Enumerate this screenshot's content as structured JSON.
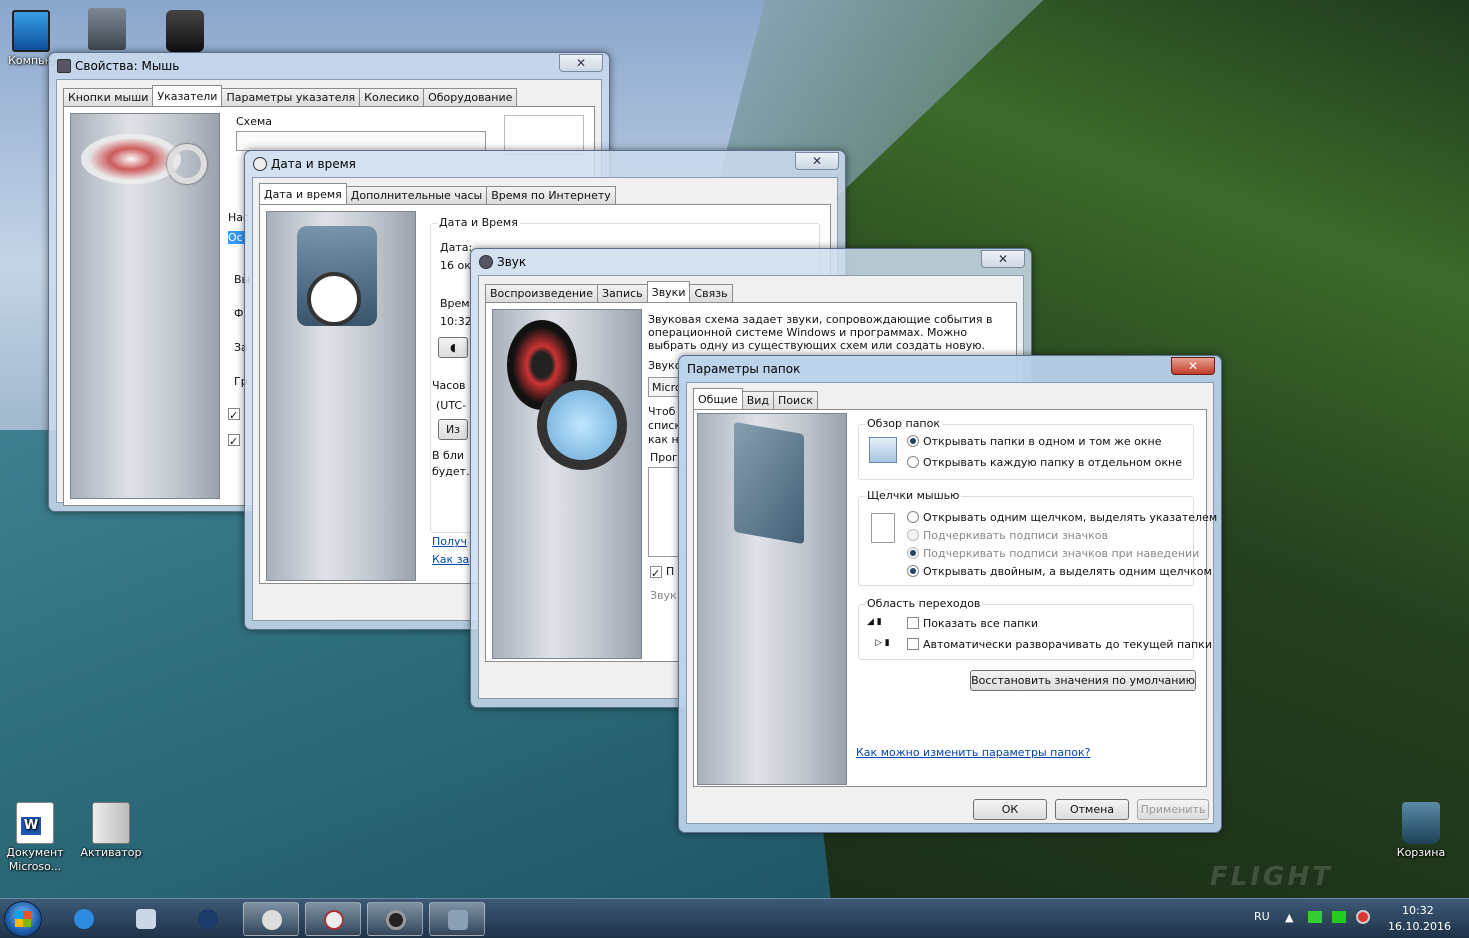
{
  "desktop": {
    "icons": [
      {
        "label": "Компью"
      },
      {
        "label": "Документ\nMicroso..."
      },
      {
        "label": "Активатор"
      },
      {
        "label": "Корзина"
      }
    ],
    "watermark": "FLIGHT"
  },
  "mouse": {
    "title": "Свойства: Мышь",
    "tabs": [
      "Кнопки мыши",
      "Указатели",
      "Параметры указателя",
      "Колесико",
      "Оборудование"
    ],
    "scheme_label": "Схема",
    "frag": [
      "Нас",
      "Ос",
      "Вы",
      "Ф",
      "За",
      "Гр"
    ]
  },
  "datetime": {
    "title": "Дата и время",
    "tabs": [
      "Дата и время",
      "Дополнительные часы",
      "Время по Интернету"
    ],
    "group": "Дата и Время",
    "frag": [
      "Дата:",
      "16 ок",
      "Врем",
      "10:32",
      "Часов",
      "(UTC-",
      "Из",
      "В бли",
      "будет.",
      "Получ",
      "Как за"
    ]
  },
  "sound": {
    "title": "Звук",
    "tabs": [
      "Воспроизведение",
      "Запись",
      "Звуки",
      "Связь"
    ],
    "desc": "Звуковая схема задает звуки, сопровождающие события в операционной системе Windows и программах. Можно выбрать одну из существующих схем или создать новую.",
    "frag": [
      "Звуко",
      "Micro",
      "Чтоб",
      "списк",
      "как н",
      "Прог",
      "П",
      "Звук"
    ]
  },
  "folder": {
    "title": "Параметры папок",
    "tabs": [
      "Общие",
      "Вид",
      "Поиск"
    ],
    "browse": {
      "label": "Обзор папок",
      "options": [
        "Открывать папки в одном и том же окне",
        "Открывать каждую папку в отдельном окне"
      ]
    },
    "click": {
      "label": "Щелчки мышью",
      "options": [
        "Открывать одним щелчком, выделять указателем",
        "Подчеркивать подписи значков",
        "Подчеркивать подписи значков при наведении",
        "Открывать двойным, а выделять одним щелчком"
      ]
    },
    "nav": {
      "label": "Область переходов",
      "options": [
        "Показать все папки",
        "Автоматически разворачивать до текущей папки"
      ]
    },
    "restore": "Восстановить значения по умолчанию",
    "help_link": "Как можно изменить параметры папок?",
    "ok": "ОК",
    "cancel": "Отмена",
    "apply": "Применить"
  },
  "taskbar": {
    "lang": "RU",
    "time": "10:32",
    "date": "16.10.2016"
  }
}
